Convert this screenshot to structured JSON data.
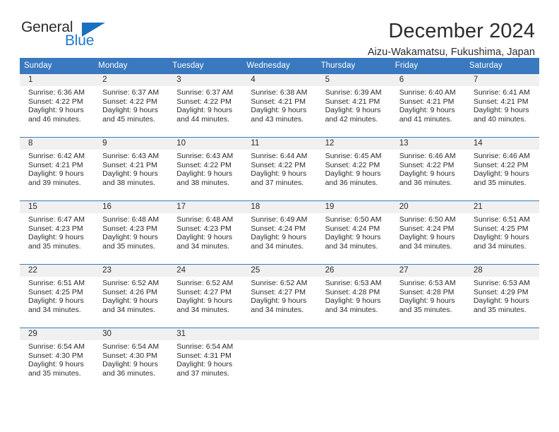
{
  "brand": {
    "name_top": "General",
    "name_bottom": "Blue",
    "triangle_icon": "triangle-icon",
    "color_top": "#2b2b2b",
    "color_bottom": "#2079c6",
    "triangle_color": "#1b6fc0"
  },
  "header": {
    "title": "December 2024",
    "subtitle": "Aizu-Wakamatsu, Fukushima, Japan"
  },
  "theme": {
    "header_blue": "#3a79bf",
    "daynum_band": "#f0f0f0",
    "text": "#2b2b2b"
  },
  "weekdays": [
    "Sunday",
    "Monday",
    "Tuesday",
    "Wednesday",
    "Thursday",
    "Friday",
    "Saturday"
  ],
  "weeks": [
    [
      {
        "day": "1",
        "sunrise": "Sunrise: 6:36 AM",
        "sunset": "Sunset: 4:22 PM",
        "daylight1": "Daylight: 9 hours",
        "daylight2": "and 46 minutes."
      },
      {
        "day": "2",
        "sunrise": "Sunrise: 6:37 AM",
        "sunset": "Sunset: 4:22 PM",
        "daylight1": "Daylight: 9 hours",
        "daylight2": "and 45 minutes."
      },
      {
        "day": "3",
        "sunrise": "Sunrise: 6:37 AM",
        "sunset": "Sunset: 4:22 PM",
        "daylight1": "Daylight: 9 hours",
        "daylight2": "and 44 minutes."
      },
      {
        "day": "4",
        "sunrise": "Sunrise: 6:38 AM",
        "sunset": "Sunset: 4:21 PM",
        "daylight1": "Daylight: 9 hours",
        "daylight2": "and 43 minutes."
      },
      {
        "day": "5",
        "sunrise": "Sunrise: 6:39 AM",
        "sunset": "Sunset: 4:21 PM",
        "daylight1": "Daylight: 9 hours",
        "daylight2": "and 42 minutes."
      },
      {
        "day": "6",
        "sunrise": "Sunrise: 6:40 AM",
        "sunset": "Sunset: 4:21 PM",
        "daylight1": "Daylight: 9 hours",
        "daylight2": "and 41 minutes."
      },
      {
        "day": "7",
        "sunrise": "Sunrise: 6:41 AM",
        "sunset": "Sunset: 4:21 PM",
        "daylight1": "Daylight: 9 hours",
        "daylight2": "and 40 minutes."
      }
    ],
    [
      {
        "day": "8",
        "sunrise": "Sunrise: 6:42 AM",
        "sunset": "Sunset: 4:21 PM",
        "daylight1": "Daylight: 9 hours",
        "daylight2": "and 39 minutes."
      },
      {
        "day": "9",
        "sunrise": "Sunrise: 6:43 AM",
        "sunset": "Sunset: 4:21 PM",
        "daylight1": "Daylight: 9 hours",
        "daylight2": "and 38 minutes."
      },
      {
        "day": "10",
        "sunrise": "Sunrise: 6:43 AM",
        "sunset": "Sunset: 4:22 PM",
        "daylight1": "Daylight: 9 hours",
        "daylight2": "and 38 minutes."
      },
      {
        "day": "11",
        "sunrise": "Sunrise: 6:44 AM",
        "sunset": "Sunset: 4:22 PM",
        "daylight1": "Daylight: 9 hours",
        "daylight2": "and 37 minutes."
      },
      {
        "day": "12",
        "sunrise": "Sunrise: 6:45 AM",
        "sunset": "Sunset: 4:22 PM",
        "daylight1": "Daylight: 9 hours",
        "daylight2": "and 36 minutes."
      },
      {
        "day": "13",
        "sunrise": "Sunrise: 6:46 AM",
        "sunset": "Sunset: 4:22 PM",
        "daylight1": "Daylight: 9 hours",
        "daylight2": "and 36 minutes."
      },
      {
        "day": "14",
        "sunrise": "Sunrise: 6:46 AM",
        "sunset": "Sunset: 4:22 PM",
        "daylight1": "Daylight: 9 hours",
        "daylight2": "and 35 minutes."
      }
    ],
    [
      {
        "day": "15",
        "sunrise": "Sunrise: 6:47 AM",
        "sunset": "Sunset: 4:23 PM",
        "daylight1": "Daylight: 9 hours",
        "daylight2": "and 35 minutes."
      },
      {
        "day": "16",
        "sunrise": "Sunrise: 6:48 AM",
        "sunset": "Sunset: 4:23 PM",
        "daylight1": "Daylight: 9 hours",
        "daylight2": "and 35 minutes."
      },
      {
        "day": "17",
        "sunrise": "Sunrise: 6:48 AM",
        "sunset": "Sunset: 4:23 PM",
        "daylight1": "Daylight: 9 hours",
        "daylight2": "and 34 minutes."
      },
      {
        "day": "18",
        "sunrise": "Sunrise: 6:49 AM",
        "sunset": "Sunset: 4:24 PM",
        "daylight1": "Daylight: 9 hours",
        "daylight2": "and 34 minutes."
      },
      {
        "day": "19",
        "sunrise": "Sunrise: 6:50 AM",
        "sunset": "Sunset: 4:24 PM",
        "daylight1": "Daylight: 9 hours",
        "daylight2": "and 34 minutes."
      },
      {
        "day": "20",
        "sunrise": "Sunrise: 6:50 AM",
        "sunset": "Sunset: 4:24 PM",
        "daylight1": "Daylight: 9 hours",
        "daylight2": "and 34 minutes."
      },
      {
        "day": "21",
        "sunrise": "Sunrise: 6:51 AM",
        "sunset": "Sunset: 4:25 PM",
        "daylight1": "Daylight: 9 hours",
        "daylight2": "and 34 minutes."
      }
    ],
    [
      {
        "day": "22",
        "sunrise": "Sunrise: 6:51 AM",
        "sunset": "Sunset: 4:25 PM",
        "daylight1": "Daylight: 9 hours",
        "daylight2": "and 34 minutes."
      },
      {
        "day": "23",
        "sunrise": "Sunrise: 6:52 AM",
        "sunset": "Sunset: 4:26 PM",
        "daylight1": "Daylight: 9 hours",
        "daylight2": "and 34 minutes."
      },
      {
        "day": "24",
        "sunrise": "Sunrise: 6:52 AM",
        "sunset": "Sunset: 4:27 PM",
        "daylight1": "Daylight: 9 hours",
        "daylight2": "and 34 minutes."
      },
      {
        "day": "25",
        "sunrise": "Sunrise: 6:52 AM",
        "sunset": "Sunset: 4:27 PM",
        "daylight1": "Daylight: 9 hours",
        "daylight2": "and 34 minutes."
      },
      {
        "day": "26",
        "sunrise": "Sunrise: 6:53 AM",
        "sunset": "Sunset: 4:28 PM",
        "daylight1": "Daylight: 9 hours",
        "daylight2": "and 34 minutes."
      },
      {
        "day": "27",
        "sunrise": "Sunrise: 6:53 AM",
        "sunset": "Sunset: 4:28 PM",
        "daylight1": "Daylight: 9 hours",
        "daylight2": "and 35 minutes."
      },
      {
        "day": "28",
        "sunrise": "Sunrise: 6:53 AM",
        "sunset": "Sunset: 4:29 PM",
        "daylight1": "Daylight: 9 hours",
        "daylight2": "and 35 minutes."
      }
    ],
    [
      {
        "day": "29",
        "sunrise": "Sunrise: 6:54 AM",
        "sunset": "Sunset: 4:30 PM",
        "daylight1": "Daylight: 9 hours",
        "daylight2": "and 35 minutes."
      },
      {
        "day": "30",
        "sunrise": "Sunrise: 6:54 AM",
        "sunset": "Sunset: 4:30 PM",
        "daylight1": "Daylight: 9 hours",
        "daylight2": "and 36 minutes."
      },
      {
        "day": "31",
        "sunrise": "Sunrise: 6:54 AM",
        "sunset": "Sunset: 4:31 PM",
        "daylight1": "Daylight: 9 hours",
        "daylight2": "and 37 minutes."
      },
      {
        "day": "",
        "sunrise": "",
        "sunset": "",
        "daylight1": "",
        "daylight2": ""
      },
      {
        "day": "",
        "sunrise": "",
        "sunset": "",
        "daylight1": "",
        "daylight2": ""
      },
      {
        "day": "",
        "sunrise": "",
        "sunset": "",
        "daylight1": "",
        "daylight2": ""
      },
      {
        "day": "",
        "sunrise": "",
        "sunset": "",
        "daylight1": "",
        "daylight2": ""
      }
    ]
  ]
}
